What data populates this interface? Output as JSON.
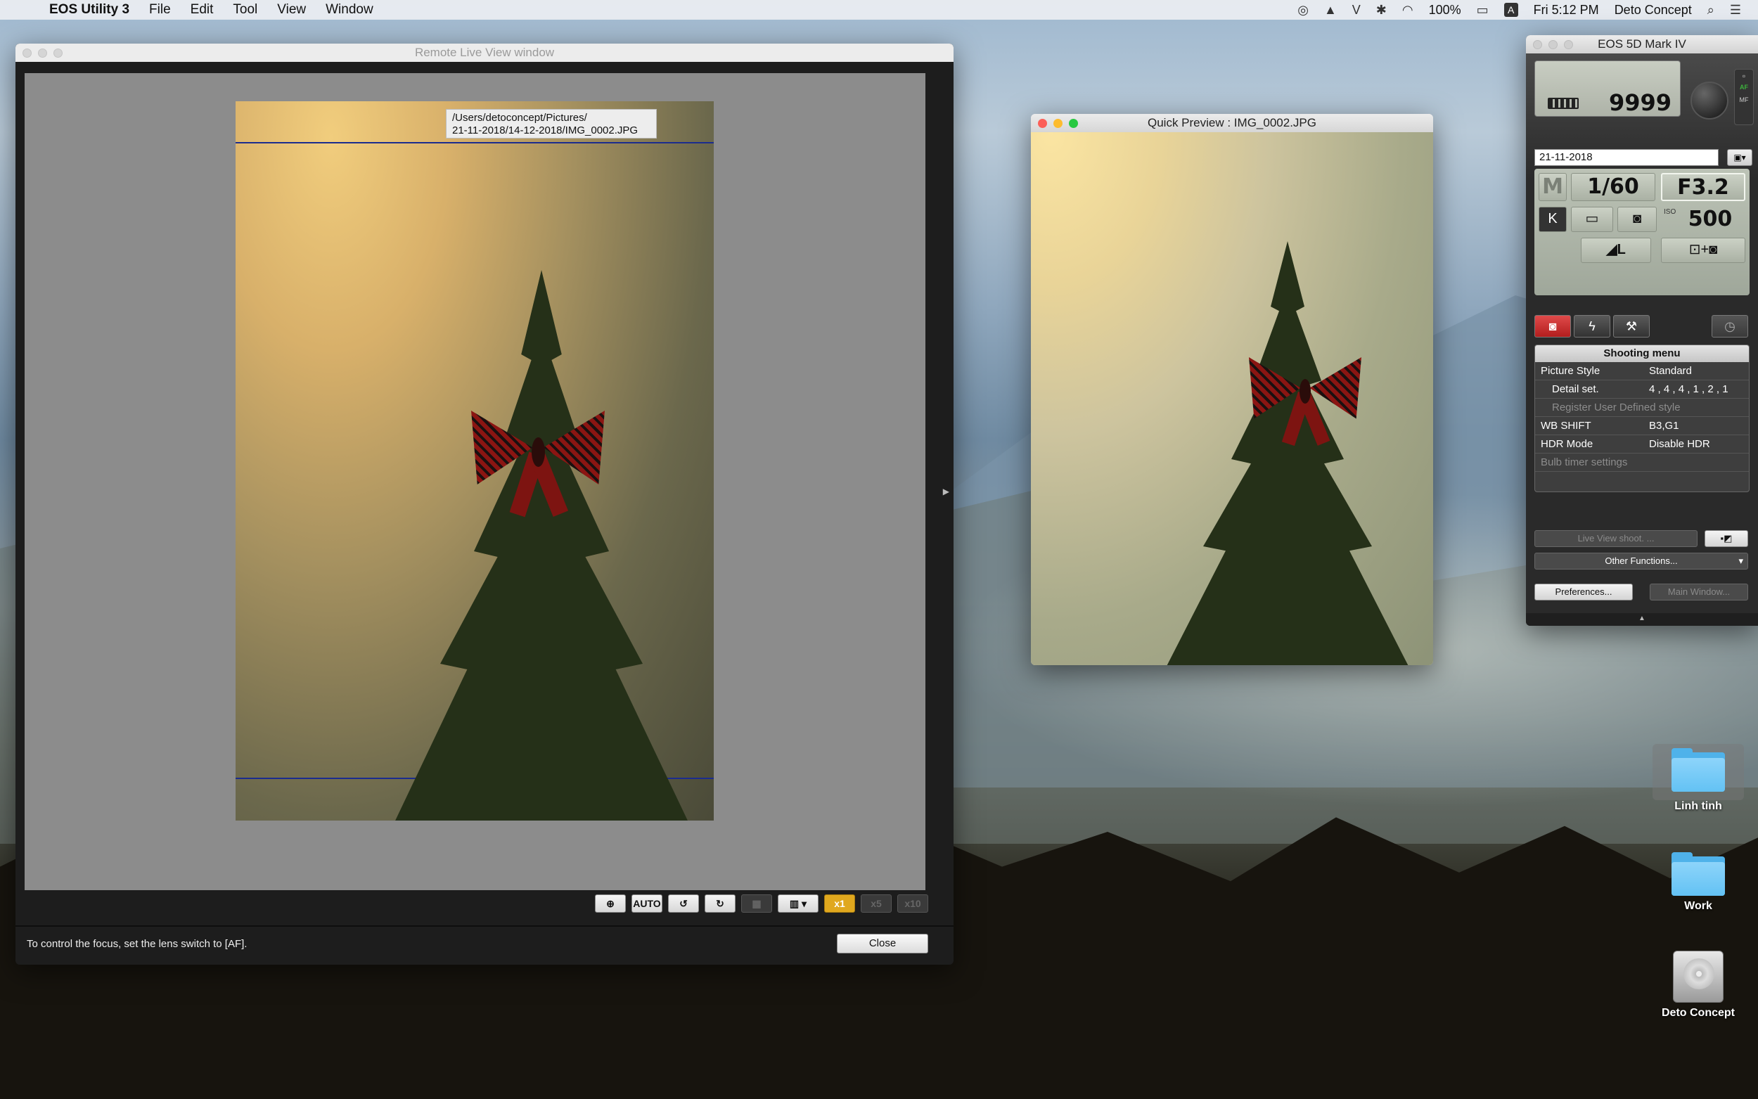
{
  "menubar": {
    "app_name": "EOS Utility 3",
    "menus": [
      "File",
      "Edit",
      "Tool",
      "View",
      "Window"
    ],
    "battery": "100%",
    "clock": "Fri 5:12 PM",
    "user": "Deto Concept"
  },
  "liveview": {
    "title": "Remote Live View window",
    "path_line1": "/Users/detoconcept/Pictures/",
    "path_line2": "21-11-2018/14-12-2018/IMG_0002.JPG",
    "toolbar": {
      "auto_label": "AUTO",
      "x1": "x1",
      "x5": "x5",
      "x10": "x10"
    },
    "message": "To control the focus, set the lens switch to [AF].",
    "close_label": "Close"
  },
  "quickview": {
    "title": "Quick Preview : IMG_0002.JPG"
  },
  "eos": {
    "title": "EOS 5D Mark IV",
    "shots_remaining": "9999",
    "af_label": "AF",
    "mf_label": "MF",
    "date_folder": "21-11-2018",
    "mode": "M",
    "shutter": "1/60",
    "aperture": "F3.2",
    "wb": "K",
    "iso_label": "ISO",
    "iso": "500",
    "quality": "◢L",
    "menu": {
      "header": "Shooting menu",
      "rows": [
        {
          "k": "Picture Style",
          "v": "Standard"
        },
        {
          "k": "Detail set.",
          "v": "4 , 4 , 4 , 1 , 2 , 1"
        },
        {
          "k": "Register User Defined style",
          "v": ""
        },
        {
          "k": "WB SHIFT",
          "v": "B3,G1"
        },
        {
          "k": "HDR Mode",
          "v": "Disable HDR"
        },
        {
          "k": "Bulb timer settings",
          "v": ""
        }
      ]
    },
    "live_view_label": "Live View shoot. ...",
    "other_functions_label": "Other Functions...",
    "preferences_label": "Preferences...",
    "main_window_label": "Main Window..."
  },
  "desktop": {
    "icons": [
      "Linh tinh",
      "Work",
      "Deto Concept"
    ]
  },
  "colors": {
    "accent_active": "#e0a81e",
    "tab_active": "#c62828",
    "guide_line": "#1b2c8e"
  }
}
